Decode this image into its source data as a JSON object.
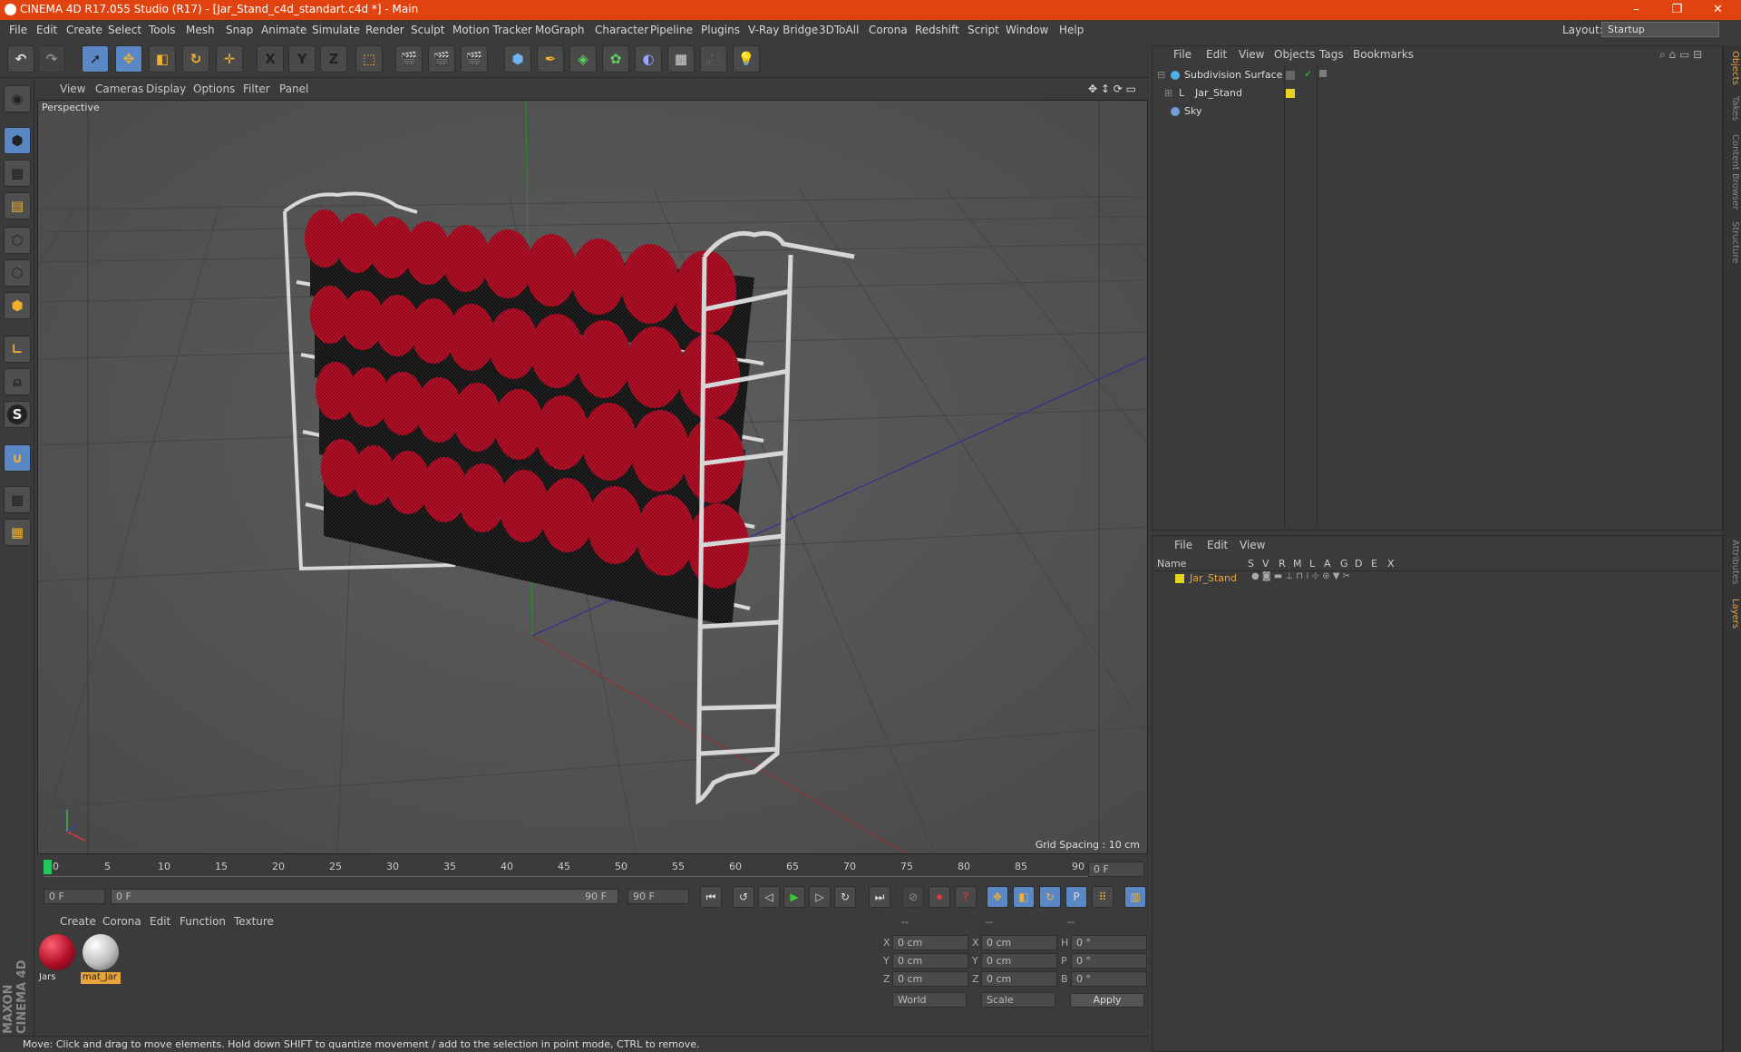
{
  "window": {
    "title": "CINEMA 4D R17.055 Studio (R17) - [Jar_Stand_c4d_standart.c4d *] - Main",
    "minimize": "–",
    "maximize": "❐",
    "close": "✕"
  },
  "menu": {
    "items": [
      "File",
      "Edit",
      "Create",
      "Select",
      "Tools",
      "Mesh",
      "Snap",
      "Animate",
      "Simulate",
      "Render",
      "Sculpt",
      "Motion Tracker",
      "MoGraph",
      "Character",
      "Pipeline",
      "Plugins",
      "V-Ray Bridge",
      "3DToAll",
      "Corona",
      "Redshift",
      "Script",
      "Window",
      "Help"
    ],
    "layout_label": "Layout:",
    "layout_value": "Startup"
  },
  "toolbar": {
    "x_label": "X",
    "y_label": "Y",
    "z_label": "Z"
  },
  "viewport": {
    "menu": [
      "View",
      "Cameras",
      "Display",
      "Options",
      "Filter",
      "Panel"
    ],
    "camera": "Perspective",
    "grid_spacing": "Grid Spacing : 10 cm"
  },
  "timeline": {
    "ticks": [
      "0",
      "5",
      "10",
      "15",
      "20",
      "25",
      "30",
      "35",
      "40",
      "45",
      "50",
      "55",
      "60",
      "65",
      "70",
      "75",
      "80",
      "85",
      "90"
    ],
    "current_frame": "0 F",
    "start_field": "0 F",
    "range_start": "0 F",
    "range_end": "90 F",
    "end_field": "90 F"
  },
  "material_manager": {
    "menu": [
      "Create",
      "Corona",
      "Edit",
      "Function",
      "Texture"
    ],
    "materials": [
      {
        "name": "Jars",
        "color": "#b01028"
      },
      {
        "name": "mat_Jar",
        "color": "#c8c8c8"
      }
    ]
  },
  "coordinates": {
    "header": [
      "--",
      "--",
      "--"
    ],
    "rows": [
      {
        "a": "X",
        "v1": "0 cm",
        "b": "X",
        "v2": "0 cm",
        "c": "H",
        "v3": "0 °"
      },
      {
        "a": "Y",
        "v1": "0 cm",
        "b": "Y",
        "v2": "0 cm",
        "c": "P",
        "v3": "0 °"
      },
      {
        "a": "Z",
        "v1": "0 cm",
        "b": "Z",
        "v2": "0 cm",
        "c": "B",
        "v3": "0 °"
      }
    ],
    "world": "World",
    "scale": "Scale",
    "apply": "Apply"
  },
  "status": "Move: Click and drag to move elements. Hold down SHIFT to quantize movement / add to the selection in point mode, CTRL to remove.",
  "object_manager": {
    "menu": [
      "File",
      "Edit",
      "View",
      "Objects",
      "Tags",
      "Bookmarks"
    ],
    "objects": [
      {
        "name": "Subdivision Surface",
        "icon_color": "#4db3e6"
      },
      {
        "name": "Jar_Stand",
        "icon_color": "#cfcfcf"
      },
      {
        "name": "Sky",
        "icon_color": "#6f9fd6"
      }
    ]
  },
  "layer_manager": {
    "menu": [
      "File",
      "Edit",
      "View"
    ],
    "columns": [
      "Name",
      "S",
      "V",
      "R",
      "M",
      "L",
      "A",
      "G",
      "D",
      "E",
      "X"
    ],
    "layers": [
      {
        "name": "Jar_Stand",
        "color": "#e6d21f"
      }
    ]
  },
  "right_tabs": [
    "Objects",
    "Takes",
    "Content Browser",
    "Structure",
    "Attributes",
    "Layers"
  ],
  "brand": "MAXON CINEMA 4D",
  "colors": {
    "title_bar": "#e0430f",
    "accent_blue": "#5a88c4",
    "selection_orange": "#e8a33c"
  }
}
